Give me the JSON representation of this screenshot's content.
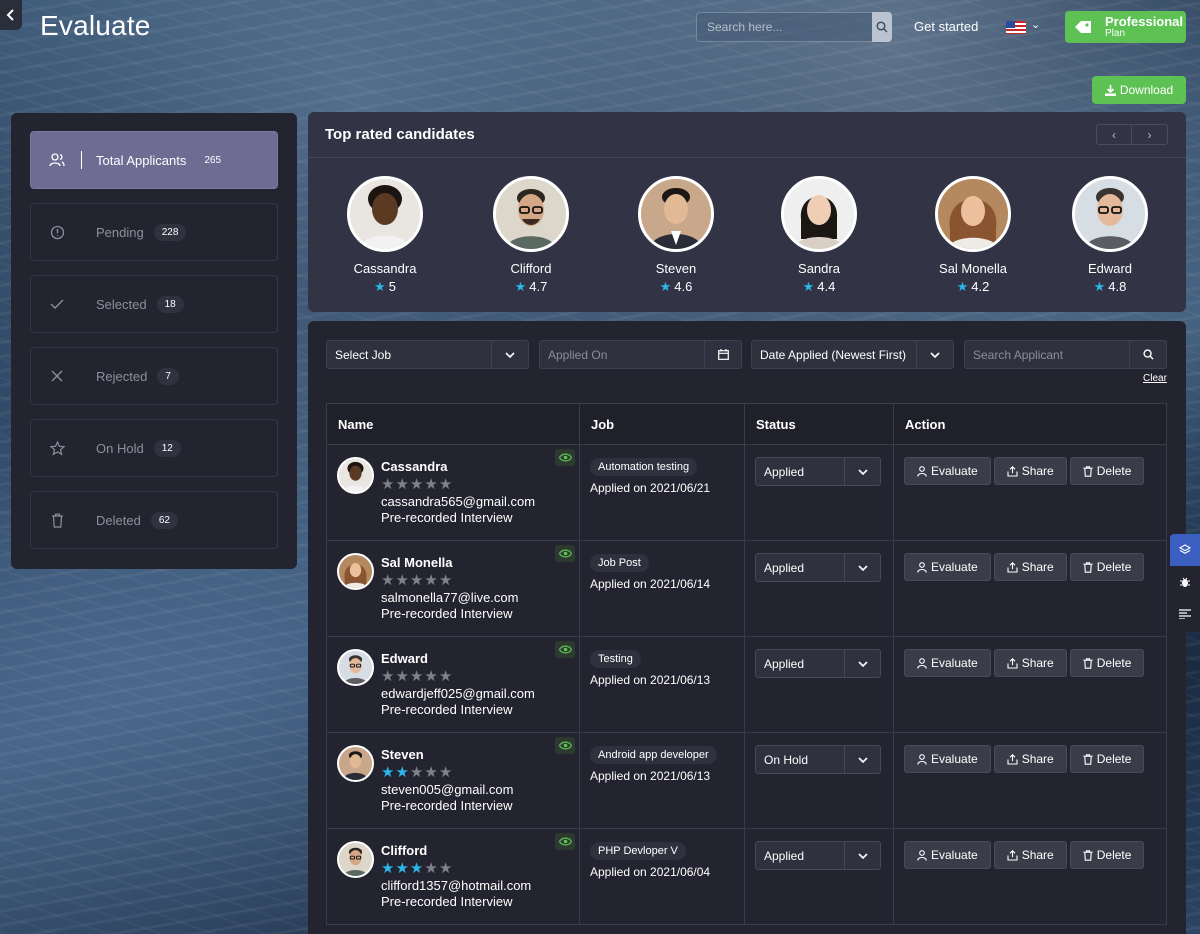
{
  "header": {
    "title": "Evaluate",
    "search_placeholder": "Search here...",
    "get_started": "Get started",
    "plan_title": "Professional",
    "plan_sub": "Plan",
    "download": "Download"
  },
  "sidebar": {
    "items": [
      {
        "label": "Total Applicants",
        "count": "265",
        "icon": "users-icon"
      },
      {
        "label": "Pending",
        "count": "228",
        "icon": "alert-circle-icon"
      },
      {
        "label": "Selected",
        "count": "18",
        "icon": "check-icon"
      },
      {
        "label": "Rejected",
        "count": "7",
        "icon": "x-icon"
      },
      {
        "label": "On Hold",
        "count": "12",
        "icon": "star-icon"
      },
      {
        "label": "Deleted",
        "count": "62",
        "icon": "trash-icon"
      }
    ]
  },
  "top_rated": {
    "title": "Top rated candidates",
    "candidates": [
      {
        "name": "Cassandra",
        "rating": "5"
      },
      {
        "name": "Clifford",
        "rating": "4.7"
      },
      {
        "name": "Steven",
        "rating": "4.6"
      },
      {
        "name": "Sandra",
        "rating": "4.4"
      },
      {
        "name": "Sal Monella",
        "rating": "4.2"
      },
      {
        "name": "Edward",
        "rating": "4.8"
      }
    ]
  },
  "filters": {
    "job": "Select Job",
    "applied_on": "Applied On",
    "sort": "Date Applied (Newest First)",
    "search_placeholder": "Search Applicant",
    "clear": "Clear"
  },
  "table": {
    "headers": [
      "Name",
      "Job",
      "Status",
      "Action"
    ],
    "actions": {
      "evaluate": "Evaluate",
      "share": "Share",
      "delete": "Delete"
    },
    "rows": [
      {
        "name": "Cassandra",
        "stars": 0,
        "email": "cassandra565@gmail.com",
        "interview": "Pre-recorded Interview",
        "job": "Automation testing",
        "date": "Applied on 2021/06/21",
        "status": "Applied"
      },
      {
        "name": "Sal Monella",
        "stars": 0,
        "email": "salmonella77@live.com",
        "interview": "Pre-recorded Interview",
        "job": "Job Post",
        "date": "Applied on 2021/06/14",
        "status": "Applied"
      },
      {
        "name": "Edward",
        "stars": 0,
        "email": "edwardjeff025@gmail.com",
        "interview": "Pre-recorded Interview",
        "job": "Testing",
        "date": "Applied on 2021/06/13",
        "status": "Applied"
      },
      {
        "name": "Steven",
        "stars": 2,
        "email": "steven005@gmail.com",
        "interview": "Pre-recorded Interview",
        "job": "Android app developer",
        "date": "Applied on 2021/06/13",
        "status": "On Hold"
      },
      {
        "name": "Clifford",
        "stars": 3,
        "email": "clifford1357@hotmail.com",
        "interview": "Pre-recorded Interview",
        "job": "PHP Devloper V",
        "date": "Applied on 2021/06/04",
        "status": "Applied"
      }
    ]
  },
  "colors": {
    "accent_green": "#5dc253",
    "star_blue": "#29b6e8",
    "active_purple": "#6e6c92"
  }
}
